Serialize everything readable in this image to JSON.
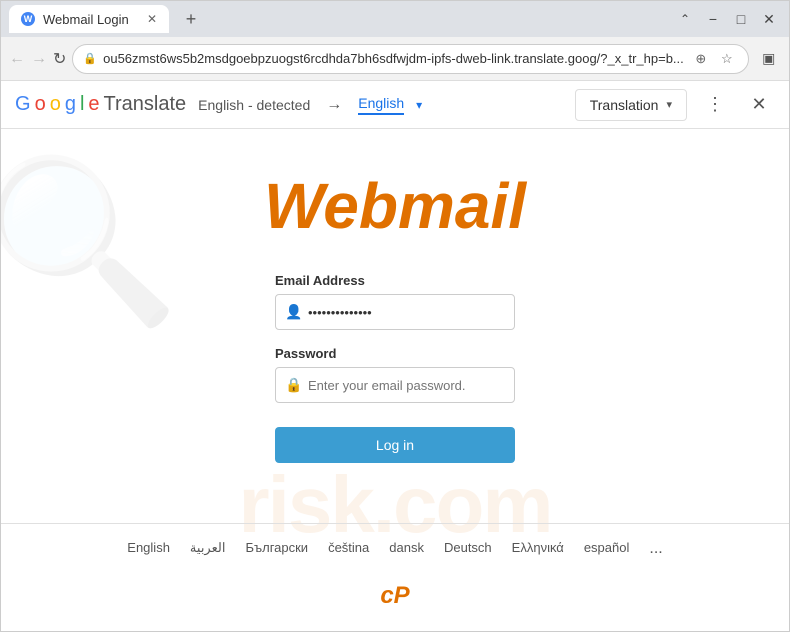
{
  "browser": {
    "tab": {
      "title": "Webmail Login",
      "favicon_label": "W"
    },
    "address": "ou56zmst6ws5b2msdgoebpzuogst6rcdhda7bh6sdfwjdm-ipfs-dweb-link.translate.goog/?_x_tr_hp=b...",
    "new_tab_label": "+",
    "window_controls": {
      "minimize": "−",
      "maximize": "□",
      "close": "✕"
    },
    "nav": {
      "back": "←",
      "forward": "→",
      "reload": "↻",
      "home": "⌂"
    }
  },
  "translate_bar": {
    "logo": {
      "letters": [
        "G",
        "o",
        "o",
        "g",
        "l",
        "e"
      ],
      "word": " Translate"
    },
    "source_lang": "English - detected",
    "arrow": "→",
    "target_lang": "English",
    "chevron": "▾",
    "translation_btn": "Translation",
    "translation_chevron": "▾",
    "menu_icon": "⋮",
    "close_icon": "✕"
  },
  "page": {
    "webmail_logo": "Webmail",
    "form": {
      "email_label": "Email Address",
      "email_placeholder": "••••••••••••••",
      "password_label": "Password",
      "password_placeholder": "Enter your email password.",
      "login_btn": "Log in"
    },
    "languages": [
      "English",
      "العربية",
      "Български",
      "čeština",
      "dansk",
      "Deutsch",
      "Ελληνικά",
      "español"
    ],
    "more_label": "...",
    "cpanel_logo": "cP"
  },
  "watermark": {
    "text": "risk.com"
  }
}
